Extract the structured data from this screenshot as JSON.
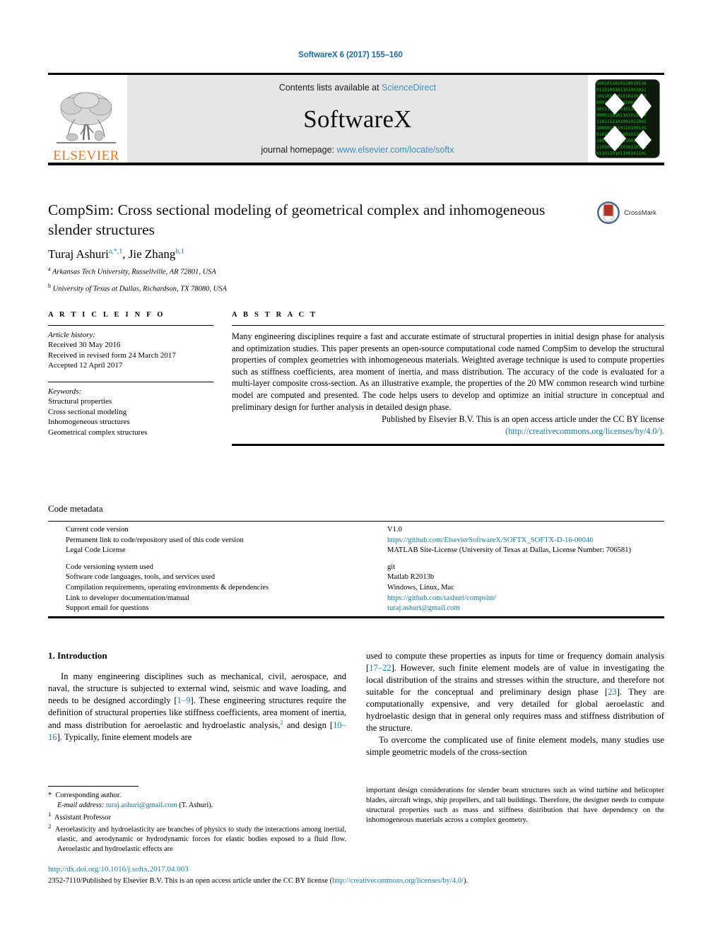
{
  "running_head": "SoftwareX 6 (2017) 155–160",
  "masthead": {
    "contents_prefix": "Contents lists available at ",
    "contents_link": "ScienceDirect",
    "journal_title": "SoftwareX",
    "homepage_prefix": "journal homepage: ",
    "homepage_link": "www.elsevier.com/locate/softx",
    "publisher_logo_word": "ELSEVIER",
    "publisher_logo_icon": "elsevier-tree-icon",
    "cover_icon": "journal-cover-thumbnail"
  },
  "article": {
    "title": "CompSim: Cross sectional modeling of geometrical complex and inhomogeneous slender structures",
    "authors_html": "Turaj Ashuri<sup>a,*,1</sup>, Jie Zhang<sup>b,1</sup>",
    "affiliation_a": "Arkansas Tech University, Russellville, AR 72801, USA",
    "affiliation_b": "University of Texas at Dallas, Richardson, TX 78080, USA",
    "crossmark_label": "CrossMark"
  },
  "article_info": {
    "section_label": "A R T I C L E   I N F O",
    "history_label": "Article history:",
    "history": [
      "Received 30 May 2016",
      "Received in revised form 24 March 2017",
      "Accepted 12 April 2017"
    ],
    "keywords_label": "Keywords:",
    "keywords": [
      "Structural properties",
      "Cross sectional modeling",
      "Inhomogeneous structures",
      "Geometrical complex structures"
    ]
  },
  "abstract": {
    "section_label": "A B S T R A C T",
    "text": "Many engineering disciplines require a fast and accurate estimate of structural properties in initial design phase for analysis and optimization studies. This paper presents an open-source computational code named CompSim to develop the structural properties of complex geometries with inhomogeneous materials. Weighted average technique is used to compute properties such as stiffness coefficients, area moment of inertia, and mass distribution. The accuracy of the code is evaluated for a multi-layer composite cross-section. As an illustrative example, the properties of the 20 MW common research wind turbine model are computed and presented. The code helps users to develop and optimize an initial structure in conceptual and preliminary design for further analysis in detailed design phase.",
    "published_line": "Published by Elsevier B.V. This is an open access article under the CC BY license",
    "license_url": "(http://creativecommons.org/licenses/by/4.0/)."
  },
  "code_metadata": {
    "title": "Code metadata",
    "rows": [
      {
        "key": "Current code version",
        "value": "V1.0",
        "link": false
      },
      {
        "key": "Permanent link to code/repository used of this code version",
        "value": "https://github.com/ElsevierSoftwareX/SOFTX_SOFTX-D-16-00046",
        "link": true
      },
      {
        "key": "Legal Code License",
        "value": "MATLAB Site-License (University of Texas at Dallas, License Number: 706581)",
        "link": false
      },
      {
        "key": "Code versioning system used",
        "value": "git",
        "link": false
      },
      {
        "key": "Software code languages, tools, and services used",
        "value": "Matlab R2013b",
        "link": false
      },
      {
        "key": "Compilation requirements, operating environments & dependencies",
        "value": "Windows, Linux, Mac",
        "link": false
      },
      {
        "key": "Link to developer documentation/manual",
        "value": "https://github.com/tashuri/compsim/",
        "link": true
      },
      {
        "key": "Support email for questions",
        "value": "turaj.ashuri@gmail.com",
        "link": true
      }
    ]
  },
  "introduction": {
    "heading": "1. Introduction",
    "left_para_1": "In many engineering disciplines such as mechanical, civil, aerospace, and naval, the structure is subjected to external wind, seismic and wave loading, and needs to be designed accordingly [1–9]. These engineering structures require the definition of structural properties like stiffness coefficients, area moment of inertia, and mass distribution for aeroelastic and hydroelastic analysis,2 and design [10–16]. Typically, finite element models are",
    "right_para_1": "used to compute these properties as inputs for time or frequency domain analysis [17–22]. However, such finite element models are of value in investigating the local distribution of the strains and stresses within the structure, and therefore not suitable for the conceptual and preliminary design phase [23]. They are computationally expensive, and very detailed for global aeroelastic and hydroelastic design that in general only requires mass and stiffness distribution of the structure.",
    "right_para_2": "To overcome the complicated use of finite element models, many studies use simple geometric models of the cross-section"
  },
  "footnotes": {
    "corresponding": "Corresponding author.",
    "email_label": "E-mail address:",
    "email": "turaj.ashuri@gmail.com",
    "email_suffix": "(T. Ashuri).",
    "note1": "Assistant Professor",
    "note2": "Aeroelasticity and hydroelasticity are branches of physics to study the interactions among inertial, elastic, and aerodynamic or hydrodynamic forces for elastic bodies exposed to a fluid flow. Aeroelastic and hydroelastic effects are",
    "note2_cont": "important design considerations for slender beam structures such as wind turbine and helicopter blades, aircraft wings, ship propellers, and tall buildings. Therefore, the designer needs to compute structural properties such as mass and stiffness distribution that have dependency on the inhomogeneous materials across a complex geometry."
  },
  "bottom": {
    "doi": "http://dx.doi.org/10.1016/j.softx.2017.04.003",
    "copyright_prefix": "2352-7110/Published by Elsevier B.V. This is an open access article under the CC BY license (",
    "copyright_link": "http://creativecommons.org/licenses/by/4.0/",
    "copyright_suffix": ")."
  },
  "colors": {
    "link": "#1a7aa8",
    "masthead_link": "#3a8fc4",
    "elsevier_orange": "#E87722",
    "masthead_bg": "#e6e6e6",
    "cover_green": "#0a8a0a"
  }
}
